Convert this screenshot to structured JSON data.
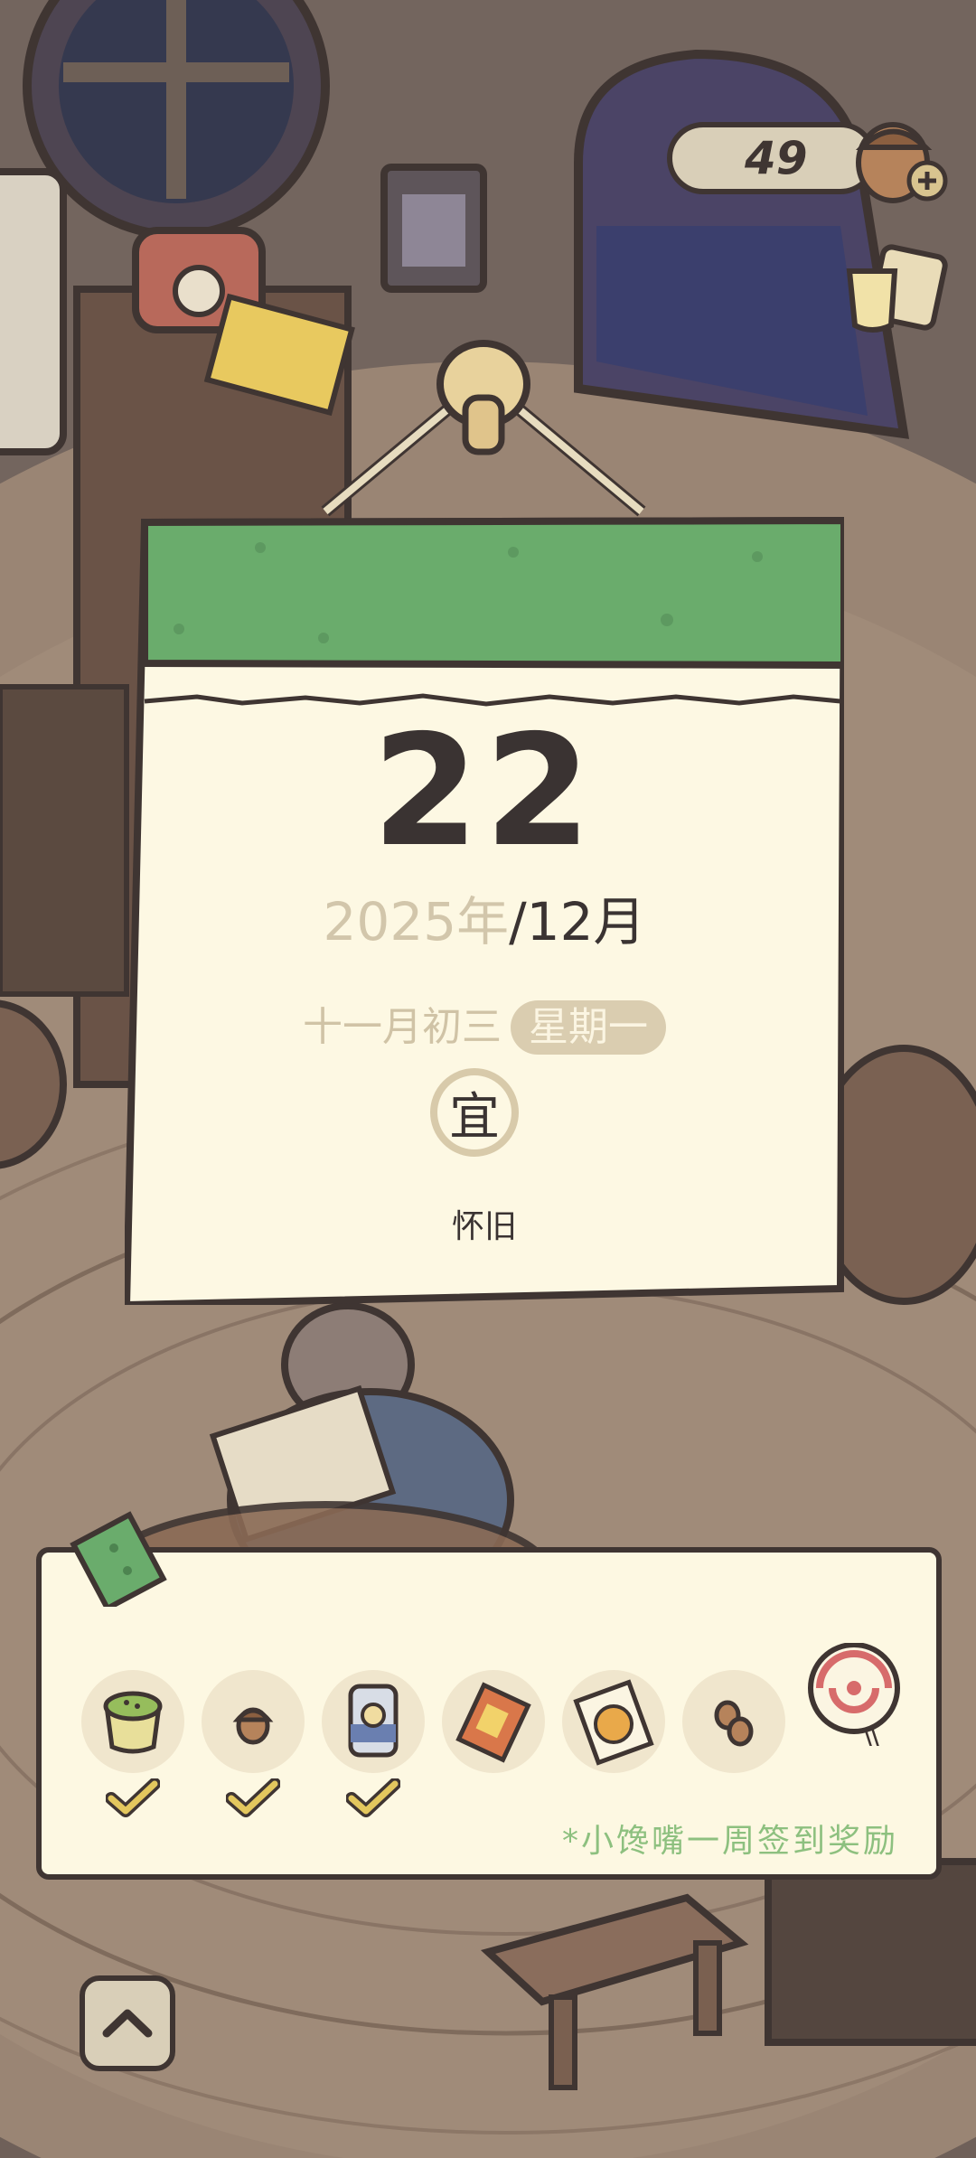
{
  "currency": {
    "count": "49"
  },
  "calendar": {
    "day": "22",
    "year": "2025年",
    "month": "/12月",
    "lunar_date": "十一月初三",
    "weekday": "星期一",
    "yi_label": "宜",
    "yi_activity": "怀旧"
  },
  "rewards": {
    "note": "*小馋嘴一周签到奖励",
    "items": [
      {
        "icon": "matcha-pudding-icon",
        "checked": true
      },
      {
        "icon": "acorn-icon",
        "checked": true
      },
      {
        "icon": "canned-food-icon",
        "checked": true
      },
      {
        "icon": "snack-bag-icon",
        "checked": false
      },
      {
        "icon": "cookie-pack-icon",
        "checked": false
      },
      {
        "icon": "peanuts-icon",
        "checked": false
      },
      {
        "icon": "lollipop-icon",
        "checked": false
      }
    ]
  },
  "colors": {
    "calendar_header": "#6aac6c",
    "calendar_paper": "#fdf8e3",
    "check": "#e3c75e",
    "note_text": "#8dc07f",
    "outline": "#3f3532"
  }
}
